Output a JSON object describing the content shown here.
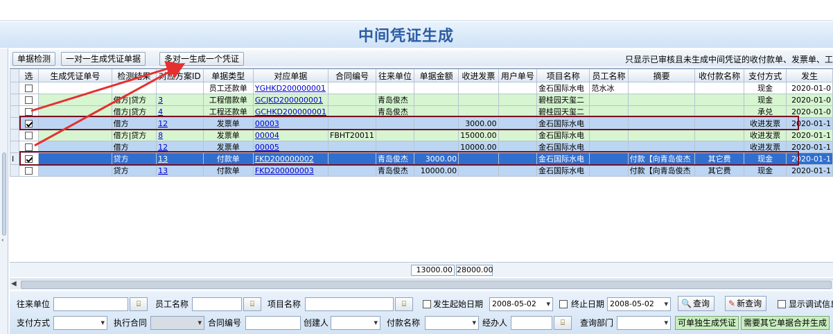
{
  "window": {
    "title": "中间凭证生成"
  },
  "toolbar": {
    "btn_check": "单据检测",
    "btn_one_to_one": "一对一生成凭证单据",
    "btn_many_to_one": "多对一生成一个凭证",
    "notice": "只显示已审核且未生成中间凭证的收付款单、发票单、工"
  },
  "grid": {
    "columns": [
      "选",
      "生成凭证单号",
      "检测结果",
      "对应方案ID",
      "单据类型",
      "对应单据",
      "合同编号",
      "往来单位",
      "单据金额",
      "收进发票",
      "用户单号",
      "项目名称",
      "员工名称",
      "摘要",
      "收付款名称",
      "支付方式",
      "发生"
    ],
    "rows": [
      {
        "style": "white",
        "checked": false,
        "voucher_no": "",
        "check_result": "",
        "scheme_id": "",
        "doc_type": "员工还款单",
        "doc_no": "YGHKD200000001",
        "contract_no": "",
        "partner": "",
        "amount": "",
        "invoice_in": "",
        "user_no": "",
        "project": "金石国际水电",
        "employee": "范水冰",
        "summary": "",
        "pay_name": "",
        "pay_method": "现金",
        "date": "2020-01-0"
      },
      {
        "style": "green",
        "checked": false,
        "voucher_no": "",
        "check_result": "借方|贷方",
        "scheme_id": "3",
        "doc_type": "工程借款单",
        "doc_no": "GCJKD200000001",
        "contract_no": "",
        "partner": "青岛俊杰",
        "amount": "",
        "invoice_in": "",
        "user_no": "",
        "project": "碧桂园天玺二",
        "employee": "",
        "summary": "",
        "pay_name": "",
        "pay_method": "现金",
        "date": "2020-01-0"
      },
      {
        "style": "green",
        "checked": false,
        "voucher_no": "",
        "check_result": "借方|贷方",
        "scheme_id": "4",
        "doc_type": "工程还款单",
        "doc_no": "GCHKD200000001",
        "contract_no": "",
        "partner": "青岛俊杰",
        "amount": "",
        "invoice_in": "",
        "user_no": "",
        "project": "碧桂园天玺二",
        "employee": "",
        "summary": "",
        "pay_name": "",
        "pay_method": "承兑",
        "date": "2020-01-0"
      },
      {
        "style": "blue",
        "checked": true,
        "voucher_no": "",
        "check_result": "借方",
        "scheme_id": "12",
        "doc_type": "发票单",
        "doc_no": "00003",
        "contract_no": "",
        "partner": "",
        "amount": "",
        "invoice_in": "3000.00",
        "user_no": "",
        "project": "金石国际水电",
        "employee": "",
        "summary": "",
        "pay_name": "",
        "pay_method": "收进发票",
        "date": "2020-01-1"
      },
      {
        "style": "green",
        "checked": false,
        "voucher_no": "",
        "check_result": "借方|贷方",
        "scheme_id": "8",
        "doc_type": "发票单",
        "doc_no": "00004",
        "contract_no": "FBHT20011",
        "partner": "",
        "amount": "",
        "invoice_in": "15000.00",
        "user_no": "",
        "project": "金石国际水电",
        "employee": "",
        "summary": "",
        "pay_name": "",
        "pay_method": "收进发票",
        "date": "2020-01-1"
      },
      {
        "style": "blue",
        "checked": false,
        "voucher_no": "",
        "check_result": "借方",
        "scheme_id": "12",
        "doc_type": "发票单",
        "doc_no": "00005",
        "contract_no": "",
        "partner": "",
        "amount": "",
        "invoice_in": "10000.00",
        "user_no": "",
        "project": "金石国际水电",
        "employee": "",
        "summary": "",
        "pay_name": "",
        "pay_method": "收进发票",
        "date": "2020-01-1"
      },
      {
        "style": "sel",
        "checked": true,
        "voucher_no": "",
        "check_result": "贷方",
        "scheme_id": "13",
        "doc_type": "付款单",
        "doc_no": "FKD200000002",
        "contract_no": "",
        "partner": "青岛俊杰",
        "amount": "3000.00",
        "invoice_in": "",
        "user_no": "",
        "project": "金石国际水电",
        "employee": "",
        "summary": "付款【向青岛俊杰",
        "pay_name": "其它费",
        "pay_method": "现金",
        "date": "2020-01-1"
      },
      {
        "style": "blue",
        "checked": false,
        "voucher_no": "",
        "check_result": "贷方",
        "scheme_id": "13",
        "doc_type": "付款单",
        "doc_no": "FKD200000003",
        "contract_no": "",
        "partner": "青岛俊杰",
        "amount": "10000.00",
        "invoice_in": "",
        "user_no": "",
        "project": "金石国际水电",
        "employee": "",
        "summary": "付款【向青岛俊杰",
        "pay_name": "其它费",
        "pay_method": "现金",
        "date": "2020-01-1"
      }
    ],
    "totals": {
      "amount": "13000.00",
      "invoice_in": "28000.00"
    }
  },
  "filters": {
    "partner_label": "往来单位",
    "employee_label": "员工名称",
    "project_label": "项目名称",
    "start_date_label": "发生起始日期",
    "start_date_value": "2008-05-02",
    "end_date_label": "终止日期",
    "end_date_value": "2008-05-02",
    "query_btn": "查询",
    "new_query_btn": "新查询",
    "debug_label": "显示调试信息",
    "pay_method_label": "支付方式",
    "exec_contract_label": "执行合同",
    "contract_no_label": "合同编号",
    "creator_label": "创建人",
    "pay_name_label": "付款名称",
    "handler_label": "经办人",
    "dept_label": "查询部门",
    "single_voucher_btn": "可单独生成凭证",
    "merge_btn": "需要其它单据合并生成"
  },
  "colors": {
    "title": "#2b5da3",
    "row_green": "#d6f5d0",
    "row_blue": "#bcd5f2",
    "row_selected": "#2f6fd0",
    "annotation_red": "#e53030",
    "highlight_box": "#7a1020"
  },
  "icons": [
    "picker-icon",
    "search-icon",
    "new-query-icon",
    "chevron-down-icon",
    "scroll-left-icon",
    "collapse-left-icon"
  ]
}
